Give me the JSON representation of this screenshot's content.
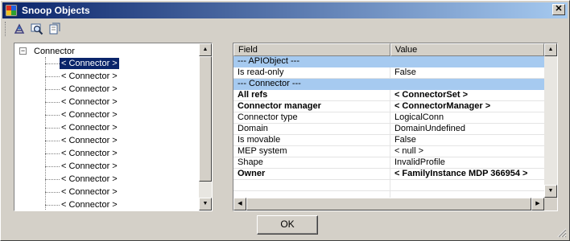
{
  "window": {
    "title": "Snoop Objects",
    "close_glyph": "✕"
  },
  "toolbar": {
    "icons": [
      "snoop-icon",
      "search-icon",
      "copy-icon"
    ]
  },
  "tree": {
    "root_label": "Connector",
    "expander_glyph": "−",
    "items": [
      "< Connector >",
      "< Connector >",
      "< Connector >",
      "< Connector >",
      "< Connector >",
      "< Connector >",
      "< Connector >",
      "< Connector >",
      "< Connector >",
      "< Connector >",
      "< Connector >",
      "< Connector >"
    ],
    "selected_index": 0
  },
  "grid": {
    "headers": {
      "field": "Field",
      "value": "Value"
    },
    "rows": [
      {
        "type": "section",
        "field": "--- APIObject ---",
        "value": ""
      },
      {
        "type": "normal",
        "field": "Is read-only",
        "value": "False"
      },
      {
        "type": "section",
        "field": "--- Connector ---",
        "value": ""
      },
      {
        "type": "bold",
        "field": "All refs",
        "value": "< ConnectorSet >"
      },
      {
        "type": "bold",
        "field": "Connector manager",
        "value": "< ConnectorManager >"
      },
      {
        "type": "normal",
        "field": "Connector type",
        "value": "LogicalConn"
      },
      {
        "type": "normal",
        "field": "Domain",
        "value": "DomainUndefined"
      },
      {
        "type": "normal",
        "field": "Is movable",
        "value": "False"
      },
      {
        "type": "normal",
        "field": "MEP system",
        "value": "< null >"
      },
      {
        "type": "normal",
        "field": "Shape",
        "value": "InvalidProfile"
      },
      {
        "type": "bold",
        "field": "Owner",
        "value": "< FamilyInstance  MDP  366954 >"
      },
      {
        "type": "normal",
        "field": "",
        "value": ""
      },
      {
        "type": "normal",
        "field": "",
        "value": ""
      }
    ]
  },
  "buttons": {
    "ok_label": "OK"
  },
  "colors": {
    "title_start": "#0a246a",
    "title_end": "#a6caf0",
    "section_row": "#a6caf0",
    "selection": "#0a246a"
  }
}
